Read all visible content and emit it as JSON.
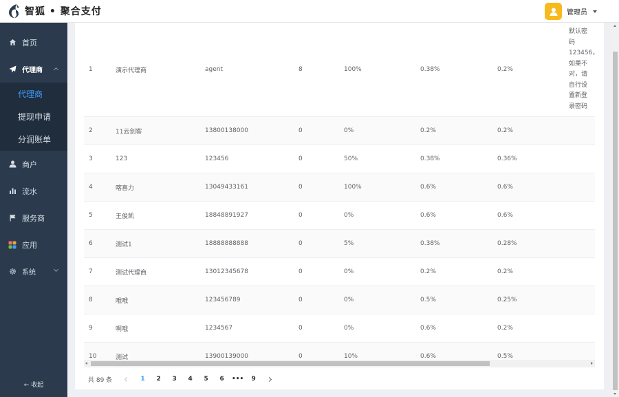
{
  "header": {
    "brand": "智狐 • 聚合支付",
    "user_name": "管理员"
  },
  "sidebar": {
    "items": [
      {
        "label": "首页",
        "icon": "home-icon"
      },
      {
        "label": "代理商",
        "icon": "send-icon",
        "expanded": true,
        "children": [
          {
            "label": "代理商",
            "active": true
          },
          {
            "label": "提现申请"
          },
          {
            "label": "分润账单"
          }
        ]
      },
      {
        "label": "商户",
        "icon": "user-icon"
      },
      {
        "label": "流水",
        "icon": "bar-chart-icon"
      },
      {
        "label": "服务商",
        "icon": "flag-icon"
      },
      {
        "label": "应用",
        "icon": "grid-icon"
      },
      {
        "label": "系统",
        "icon": "gear-icon"
      }
    ],
    "collapse_label": "← 收起"
  },
  "table": {
    "rows": [
      [
        "1",
        "演示代理商",
        "agent",
        "8",
        "100%",
        "0.38%",
        "0.2%",
        "默认密码123456，如果不对，请自行设置新登录密码"
      ],
      [
        "2",
        "11云剑客",
        "13800138000",
        "0",
        "0%",
        "0.2%",
        "0.2%",
        ""
      ],
      [
        "3",
        "123",
        "123456",
        "0",
        "50%",
        "0.38%",
        "0.36%",
        ""
      ],
      [
        "4",
        "喀喜力",
        "13049433161",
        "0",
        "100%",
        "0.6%",
        "0.6%",
        ""
      ],
      [
        "5",
        "王俊凯",
        "18848891927",
        "0",
        "0%",
        "0.6%",
        "0.6%",
        ""
      ],
      [
        "6",
        "测试1",
        "18888888888",
        "0",
        "5%",
        "0.38%",
        "0.28%",
        ""
      ],
      [
        "7",
        "测试代理商",
        "13012345678",
        "0",
        "0%",
        "0.2%",
        "0.2%",
        ""
      ],
      [
        "8",
        "哦哦",
        "123456789",
        "0",
        "0%",
        "0.5%",
        "0.25%",
        ""
      ],
      [
        "9",
        "啊哦",
        "1234567",
        "0",
        "0%",
        "0.6%",
        "0.2%",
        ""
      ],
      [
        "10",
        "测试",
        "13900139000",
        "0",
        "10%",
        "0.6%",
        "0.5%",
        ""
      ]
    ]
  },
  "pagination": {
    "total": "共 89 条",
    "pages": [
      "1",
      "2",
      "3",
      "4",
      "5",
      "6",
      "•••",
      "9"
    ],
    "current": "1"
  },
  "colors": {
    "sidebar": "#2b3a4d",
    "submenu": "#1f2d3d",
    "accent": "#409eff",
    "avatar": "#f7ba1e"
  }
}
